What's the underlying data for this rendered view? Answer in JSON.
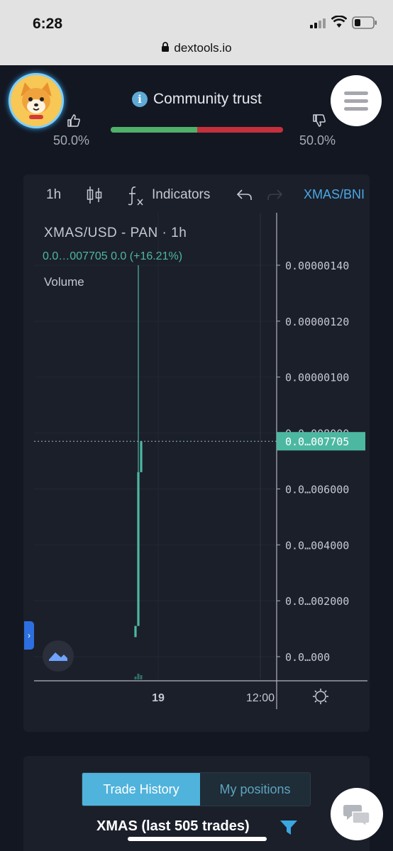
{
  "status": {
    "time": "6:28",
    "url": "dextools.io"
  },
  "header": {
    "community_title": "Community trust",
    "up_pct": "50.0%",
    "down_pct": "50.0%",
    "trust_up_fraction": 0.5,
    "colors": {
      "up": "#4fb06a",
      "down": "#c5303d"
    }
  },
  "toolbar": {
    "interval": "1h",
    "candles_icon": "candles-icon",
    "indicators_label": "Indicators",
    "pair": "XMAS/BNI"
  },
  "legend": {
    "title": "XMAS/USD - PAN · 1h",
    "price": "0.0…007705  0.0 (+16.21%)",
    "volume": "Volume"
  },
  "chart_data": {
    "type": "line",
    "title": "XMAS/USD - PAN · 1h",
    "y_ticks": [
      "0.00000140",
      "0.00000120",
      "0.00000100",
      "0.0…008000",
      "0.0…006000",
      "0.0…004000",
      "0.0…002000",
      "0.0…000"
    ],
    "y_tick_values": [
      1.4e-06,
      1.2e-06,
      1e-06,
      8e-07,
      6e-07,
      4e-07,
      2e-07,
      0
    ],
    "x_ticks": [
      "19",
      "12:00"
    ],
    "last_price_label": "0.0…007705",
    "last_price_value": 7.705e-07,
    "ylim": [
      0,
      1.4e-06
    ],
    "candles": [
      {
        "open": 7e-08,
        "close": 1.1e-07,
        "high": 1.1e-07,
        "low": 7e-08
      },
      {
        "open": 1.1e-07,
        "close": 6.6e-07,
        "high": 1.4e-06,
        "low": 1.1e-07
      },
      {
        "open": 6.6e-07,
        "close": 7.7e-07,
        "high": 7.7e-07,
        "low": 6.6e-07
      }
    ],
    "color": "#4db8a2",
    "grid": true
  },
  "trades": {
    "tab_history": "Trade History",
    "tab_positions": "My positions",
    "title": "XMAS (last 505 trades)"
  }
}
